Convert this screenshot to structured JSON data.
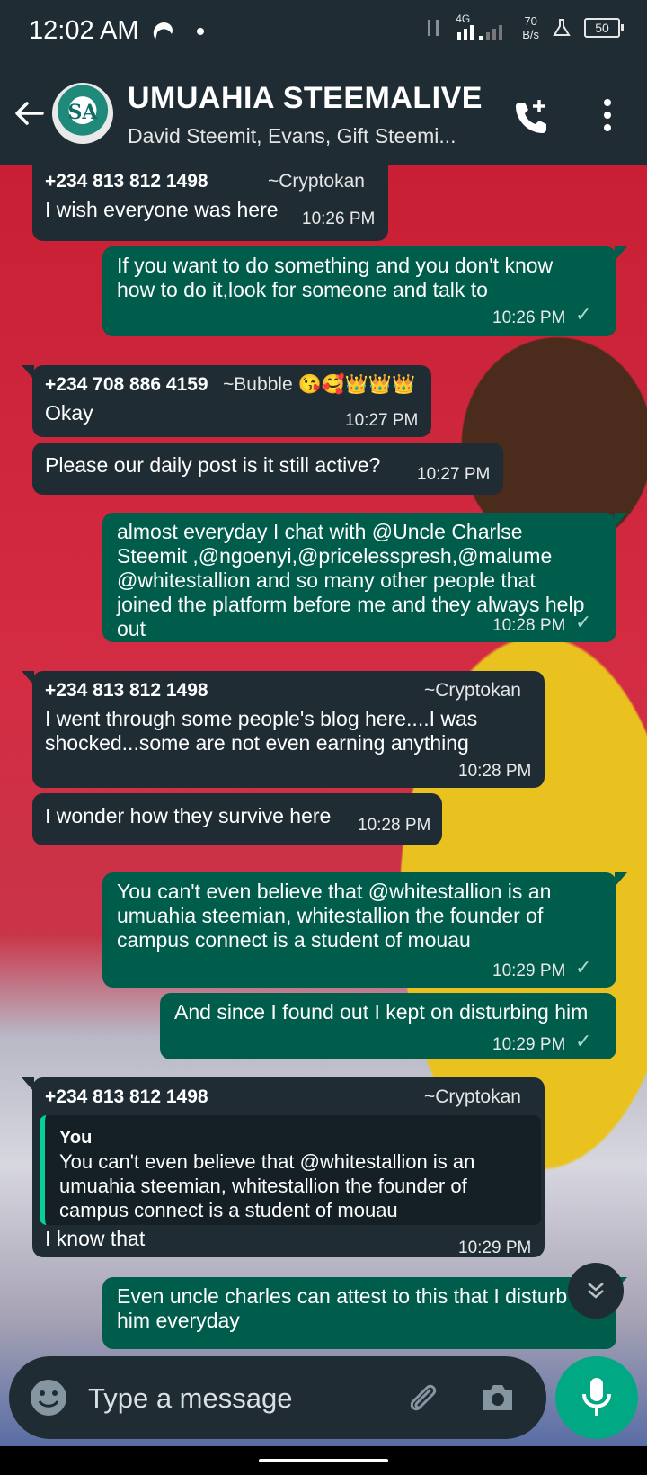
{
  "status_bar": {
    "time": "12:02 AM",
    "network": "4G",
    "speed_value": "70",
    "speed_unit": "B/s",
    "battery": "50"
  },
  "header": {
    "title": "UMUAHIA STEEMALIVE",
    "subtitle": "David Steemit, Evans, Gift Steemi...",
    "avatar_letters": "SA",
    "icons": [
      "back-arrow-icon",
      "group-avatar",
      "add-call-icon",
      "more-options-icon"
    ]
  },
  "messages": [
    {
      "direction": "in",
      "sender": "+234 813 812 1498",
      "alias": "~Cryptokan",
      "text": "I wish everyone was here",
      "time": "10:26 PM"
    },
    {
      "direction": "out",
      "text": "If you want to do something and you don't know how to do it,look for someone and talk to",
      "time": "10:26 PM",
      "status": "✓"
    },
    {
      "direction": "in",
      "sender": "+234 708 886 4159",
      "alias": "~Bubble 😘🥰👑👑👑",
      "text": "Okay",
      "time": "10:27 PM"
    },
    {
      "direction": "in",
      "text": "Please our daily post is it still active?",
      "time": "10:27 PM"
    },
    {
      "direction": "out",
      "text": "almost everyday I chat with @Uncle Charlse Steemit ,@ngoenyi,@pricelesspresh,@malume @whitestallion and so many other people that joined the platform before me and they always help out",
      "time": "10:28 PM",
      "status": "✓"
    },
    {
      "direction": "in",
      "sender": "+234 813 812 1498",
      "alias": "~Cryptokan",
      "text": "I went through some people's blog here....I was shocked...some are not even earning anything",
      "time": "10:28 PM"
    },
    {
      "direction": "in",
      "text": "I wonder how they survive here",
      "time": "10:28 PM"
    },
    {
      "direction": "out",
      "text": "You can't even believe that @whitestallion is an umuahia steemian, whitestallion the founder of campus connect is a student of mouau",
      "time": "10:29 PM",
      "status": "✓"
    },
    {
      "direction": "out",
      "text": "And since I found out I kept on disturbing him",
      "time": "10:29 PM",
      "status": "✓"
    },
    {
      "direction": "in",
      "sender": "+234 813 812 1498",
      "alias": "~Cryptokan",
      "quote_author": "You",
      "quote_text": "You can't even believe that @whitestallion is an umuahia steemian, whitestallion the founder of campus connect is a student of mouau",
      "text": "I know that",
      "time": "10:29 PM"
    },
    {
      "direction": "out",
      "text": "Even uncle charles can attest to this that I disturb him everyday"
    }
  ],
  "composer": {
    "placeholder": "Type a message",
    "icons": [
      "emoji-icon",
      "attach-icon",
      "camera-icon",
      "microphone-icon"
    ]
  },
  "colors": {
    "header_bg": "#1f2c34",
    "incoming_bubble": "#1f2c34",
    "outgoing_bubble": "#005c4b",
    "mic_button": "#00a884",
    "quote_bar": "#06cf9c"
  }
}
